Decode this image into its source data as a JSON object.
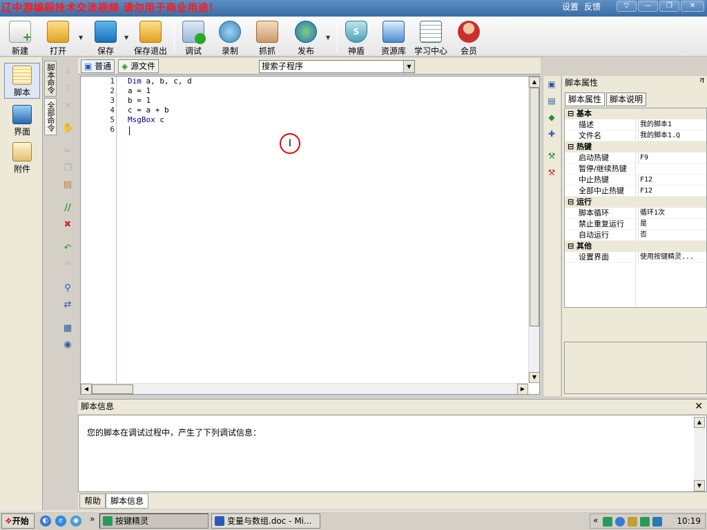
{
  "window": {
    "banner": "辽中游编程技术交流视频 请勿用于商业用途!",
    "settings_link": "设置",
    "feedback_link": "反馈",
    "controls": {
      "dropdown": "▽",
      "minimize": "—",
      "restore": "❐",
      "close": "✕"
    }
  },
  "toolbar": {
    "new": "新建",
    "open": "打开",
    "save": "保存",
    "save_exit": "保存退出",
    "debug": "调试",
    "record": "录制",
    "capture": "抓抓",
    "publish": "发布",
    "shield": "神盾",
    "resources": "资源库",
    "learn": "学习中心",
    "member": "会员"
  },
  "sidebar": {
    "script": "脚本",
    "ui": "界面",
    "attachments": "附件"
  },
  "vtabs": {
    "script_commands": "脚本命令",
    "all_commands": "全部命令"
  },
  "editor": {
    "tab_normal": "普通",
    "tab_source": "源文件",
    "subroutine_search": "搜索子程序",
    "lines": [
      {
        "num": "1",
        "kw": "Dim",
        "rest": " a, b, c, d"
      },
      {
        "num": "2",
        "kw": "",
        "rest": "a = 1"
      },
      {
        "num": "3",
        "kw": "",
        "rest": "b = 1"
      },
      {
        "num": "4",
        "kw": "",
        "rest": "c = a + b"
      },
      {
        "num": "5",
        "kw": "MsgBox",
        "rest": " c"
      },
      {
        "num": "6",
        "kw": "",
        "rest": ""
      }
    ]
  },
  "properties": {
    "title": "脚本属性",
    "pin": "ቫ",
    "tab_props": "脚本属性",
    "tab_desc": "脚本说明",
    "groups": [
      {
        "name": "基本",
        "items": [
          {
            "k": "描述",
            "v": "我的脚本1"
          },
          {
            "k": "文件名",
            "v": "我的脚本1.Q"
          }
        ]
      },
      {
        "name": "热键",
        "items": [
          {
            "k": "启动热键",
            "v": "F9"
          },
          {
            "k": "暂停/继续热键",
            "v": ""
          },
          {
            "k": "中止热键",
            "v": "F12"
          },
          {
            "k": "全部中止热键",
            "v": "F12"
          }
        ]
      },
      {
        "name": "运行",
        "items": [
          {
            "k": "脚本循环",
            "v": "循环1次"
          },
          {
            "k": "禁止重复运行",
            "v": "是"
          },
          {
            "k": "自动运行",
            "v": "否"
          }
        ]
      },
      {
        "name": "其他",
        "items": [
          {
            "k": "设置界面",
            "v": "使用按键精灵..."
          }
        ]
      }
    ]
  },
  "info": {
    "title": "脚本信息",
    "message": "您的脚本在调试过程中，产生了下列调试信息：",
    "tab_help": "帮助",
    "tab_info": "脚本信息"
  },
  "taskbar": {
    "start": "开始",
    "task1": "按键精灵",
    "task2": "变量与数组.doc - Mi...",
    "chevron": "»",
    "tray_chevron": "«",
    "clock": "10:19"
  }
}
